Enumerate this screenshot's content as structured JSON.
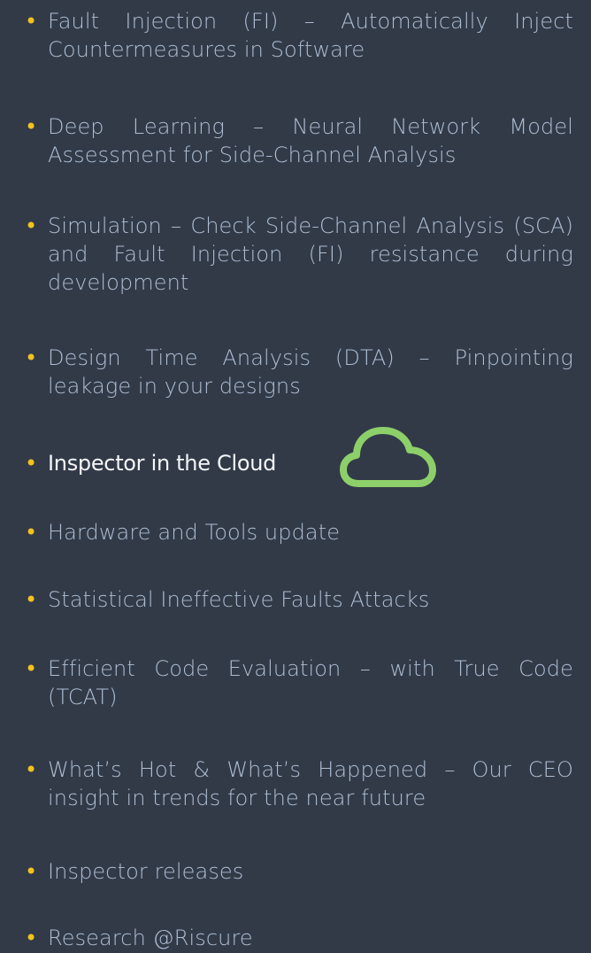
{
  "accent_colors": {
    "background": "#323a48",
    "bullet": "#f2c21d",
    "text": "#aebed3",
    "highlight_text": "#f4f6f8",
    "cloud": "#8dd06a"
  },
  "agenda": [
    {
      "bullet": "•",
      "text": "Fault Injection (FI) – Automatically Inject Countermeasures in Software"
    },
    {
      "bullet": "•",
      "text": "Deep Learning – Neural Network Model Assessment for Side-Channel Analysis"
    },
    {
      "bullet": "•",
      "text": "Simulation – Check Side-Channel Analysis (SCA) and Fault Injection (FI) resistance during development"
    },
    {
      "bullet": "•",
      "text": "Design Time Analysis (DTA) – Pinpointing leakage in your designs"
    },
    {
      "bullet": "•",
      "text": "Inspector in the Cloud",
      "icon": "cloud-icon"
    },
    {
      "bullet": "•",
      "text": "Hardware and Tools update"
    },
    {
      "bullet": "•",
      "text": "Statistical Ineffective Faults Attacks"
    },
    {
      "bullet": "•",
      "text": "Efficient Code Evaluation – with True Code (TCAT)"
    },
    {
      "bullet": "•",
      "text": "What’s Hot & What’s Happened – Our CEO insight in trends for the near future"
    },
    {
      "bullet": "•",
      "text": "Inspector releases"
    },
    {
      "bullet": "•",
      "text": "Research @Riscure"
    }
  ]
}
